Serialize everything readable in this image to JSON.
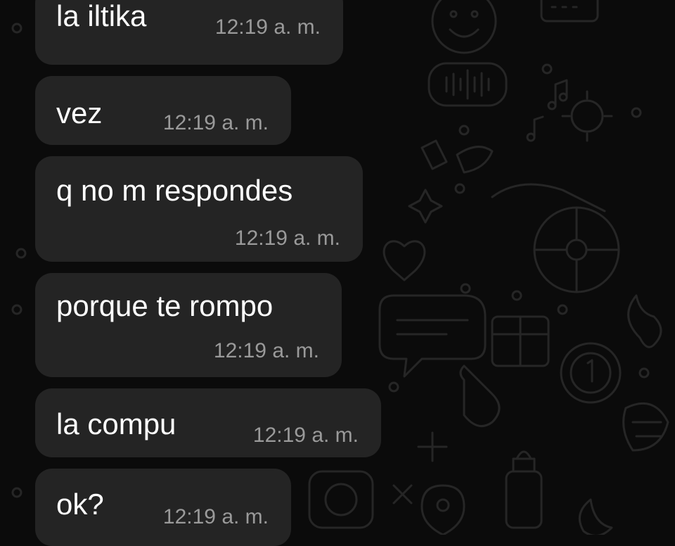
{
  "messages": [
    {
      "text": "la iltika",
      "time": "12:19 a. m."
    },
    {
      "text": "vez",
      "time": "12:19 a. m."
    },
    {
      "text": "q no m respondes",
      "time": "12:19 a. m."
    },
    {
      "text": "porque te rompo",
      "time": "12:19 a. m."
    },
    {
      "text": "la compu",
      "time": "12:19 a. m."
    },
    {
      "text": "ok?",
      "time": "12:19 a. m."
    }
  ],
  "colors": {
    "background": "#0b0b0b",
    "bubble": "#242424",
    "text": "#ffffff",
    "timestamp": "#9a9a9a",
    "doodle": "#262626"
  }
}
